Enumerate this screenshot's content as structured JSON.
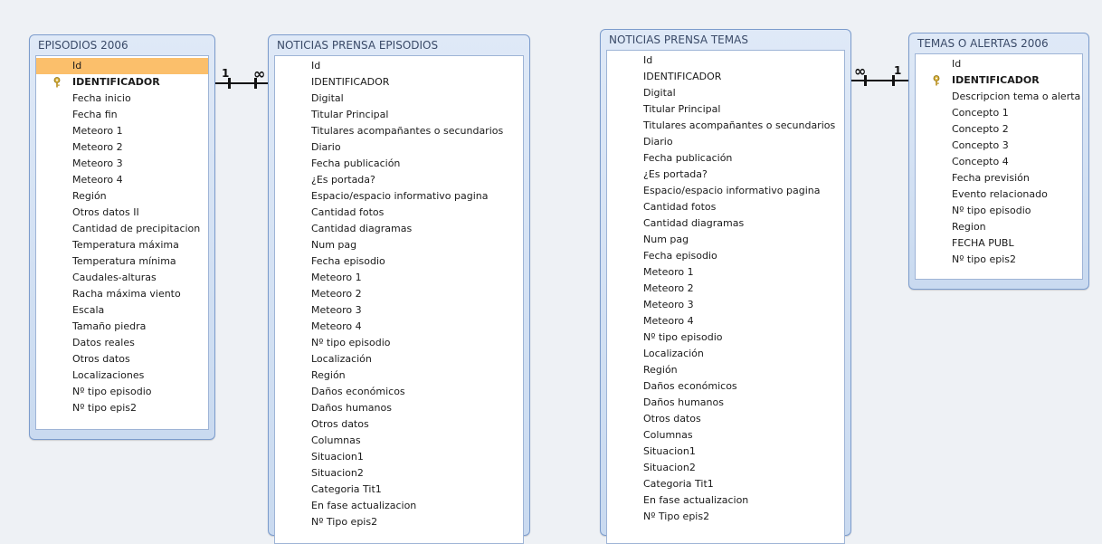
{
  "tables": [
    {
      "title": "EPISODIOS 2006",
      "fields": [
        "Id",
        "IDENTIFICADOR",
        "Fecha inicio",
        "Fecha fin",
        "Meteoro 1",
        "Meteoro 2",
        "Meteoro 3",
        "Meteoro 4",
        "Región",
        "Otros datos II",
        "Cantidad de precipitacion",
        "Temperatura máxima",
        "Temperatura mínima",
        "Caudales-alturas",
        "Racha máxima viento",
        "Escala",
        "Tamaño piedra",
        "Datos reales",
        "Otros datos",
        "Localizaciones",
        "Nº tipo episodio",
        "Nº tipo epis2"
      ]
    },
    {
      "title": "NOTICIAS PRENSA EPISODIOS",
      "fields": [
        "Id",
        "IDENTIFICADOR",
        "Digital",
        "Titular Principal",
        "Titulares acompañantes o secundarios",
        "Diario",
        "Fecha publicación",
        "¿Es portada?",
        "Espacio/espacio informativo pagina",
        "Cantidad fotos",
        "Cantidad diagramas",
        "Num pag",
        "Fecha episodio",
        "Meteoro 1",
        "Meteoro 2",
        "Meteoro 3",
        "Meteoro 4",
        "Nº tipo episodio",
        "Localización",
        "Región",
        "Daños económicos",
        "Daños humanos",
        "Otros datos",
        "Columnas",
        "Situacion1",
        "Situacion2",
        "Categoria Tit1",
        "En fase actualizacion",
        "Nº Tipo epis2"
      ]
    },
    {
      "title": "NOTICIAS PRENSA TEMAS",
      "fields": [
        "Id",
        "IDENTIFICADOR",
        "Digital",
        "Titular Principal",
        "Titulares acompañantes o secundarios",
        "Diario",
        "Fecha publicación",
        "¿Es portada?",
        "Espacio/espacio informativo pagina",
        "Cantidad fotos",
        "Cantidad diagramas",
        "Num pag",
        "Fecha episodio",
        "Meteoro 1",
        "Meteoro 2",
        "Meteoro 3",
        "Meteoro 4",
        "Nº tipo episodio",
        "Localización",
        "Región",
        "Daños económicos",
        "Daños humanos",
        "Otros datos",
        "Columnas",
        "Situacion1",
        "Situacion2",
        "Categoria Tit1",
        "En fase actualizacion",
        "Nº Tipo epis2"
      ]
    },
    {
      "title": "TEMAS O ALERTAS 2006",
      "fields": [
        "Id",
        "IDENTIFICADOR",
        "Descripcion tema o alerta",
        "Concepto 1",
        "Concepto 2",
        "Concepto 3",
        "Concepto 4",
        "Fecha previsión",
        "Evento relacionado",
        "Nº tipo episodio",
        "Region",
        "FECHA PUBL",
        "Nº tipo epis2"
      ]
    }
  ],
  "relationships": [
    {
      "one_label": "1",
      "many_label": "∞"
    },
    {
      "one_label": "1",
      "many_label": "∞"
    }
  ]
}
